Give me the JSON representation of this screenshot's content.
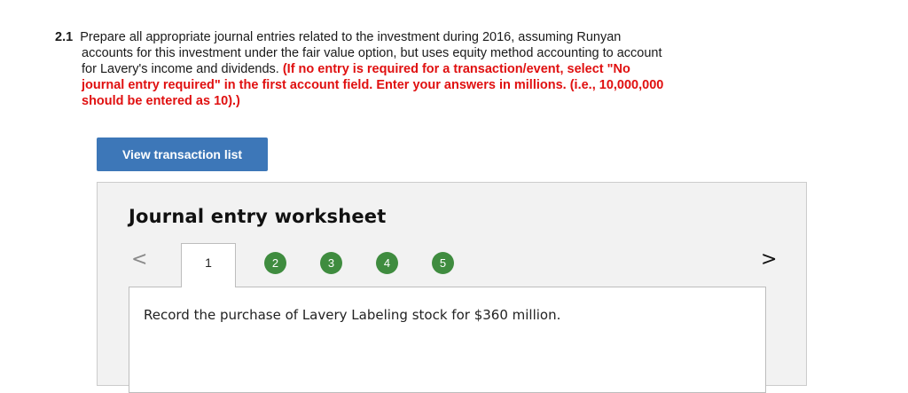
{
  "question": {
    "number": "2.1",
    "line1": "Prepare all appropriate journal entries related to the investment during 2016, assuming Runyan",
    "line2": "accounts for this investment under the fair value option, but uses equity method accounting to account",
    "line3": "for Lavery's income and dividends.",
    "instruction_a": "(If no entry is required for a transaction/event, select \"No",
    "instruction_b": "journal entry required\" in the first account field. Enter your answers in millions. (i.e., 10,000,000",
    "instruction_c": "should be entered as 10).)"
  },
  "view_button": {
    "label": "View transaction list"
  },
  "worksheet": {
    "title": "Journal entry worksheet",
    "prev_symbol": "<",
    "next_symbol": ">",
    "active_tab": "1",
    "steps": [
      "2",
      "3",
      "4",
      "5"
    ],
    "prompt": "Record the purchase of Lavery Labeling stock for $360 million."
  },
  "colors": {
    "accent_blue": "#3d77b8",
    "step_green": "#3f8c3f",
    "instruction_red": "#e01010"
  }
}
